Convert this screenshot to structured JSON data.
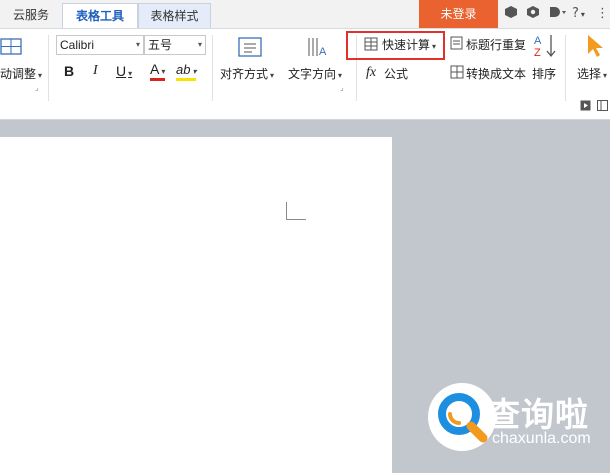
{
  "tabs": [
    {
      "label": "云服务"
    },
    {
      "label": "表格工具"
    },
    {
      "label": "表格样式"
    }
  ],
  "header": {
    "login_label": "未登录",
    "help_label": "?"
  },
  "ribbon": {
    "auto_fit_label": "动调整",
    "font_name": "Calibri",
    "font_size": "五号",
    "bold": "B",
    "italic": "I",
    "underline": "U",
    "font_color": "A",
    "highlight_mark": "ab",
    "align_label": "对齐方式",
    "text_direction_label": "文字方向",
    "quick_calc_label": "快速计算",
    "formula_symbol": "fx",
    "formula_label": "公式",
    "repeat_header_label": "标题行重复",
    "convert_text_label": "转换成文本",
    "sort_label": "排序",
    "select_label": "选择"
  },
  "watermark": {
    "title": "查询啦",
    "url": "chaxunla.com"
  },
  "colors": {
    "accent_tab": "#1e5fbf",
    "login_bg": "#e9622f",
    "highlight_box": "#e0312b",
    "workspace_bg": "#c2c6cd",
    "watermark_blue": "#1e8fe0",
    "watermark_orange": "#f39a1e"
  }
}
